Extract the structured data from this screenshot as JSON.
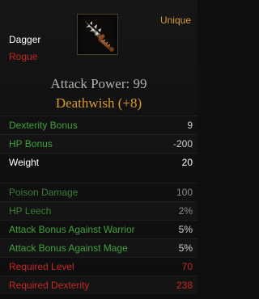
{
  "item": {
    "type": "Dagger",
    "class": "Rogue",
    "rarity": "Unique",
    "icon": "spiked-dagger-icon",
    "attack_power": "Attack Power: 99",
    "enchant": "Deathwish (+8)"
  },
  "stats": [
    {
      "label": "Dexterity Bonus",
      "value": "9"
    },
    {
      "label": "HP Bonus",
      "value": "-200"
    },
    {
      "label": "Weight",
      "value": "20"
    },
    {
      "label": "Poison Damage",
      "value": "100"
    },
    {
      "label": "HP Leech",
      "value": "2%"
    },
    {
      "label": "Attack Bonus Against Warrior",
      "value": "5%"
    },
    {
      "label": "Attack Bonus Against Mage",
      "value": "5%"
    },
    {
      "label": "Required Level",
      "value": "70"
    },
    {
      "label": "Required Dexterity",
      "value": "238"
    }
  ],
  "colors": {
    "background": "#111112",
    "unique": "#d79a2f",
    "bonus": "#3fa23b",
    "requirement": "#c22a22",
    "title": "#b5b0a6"
  }
}
